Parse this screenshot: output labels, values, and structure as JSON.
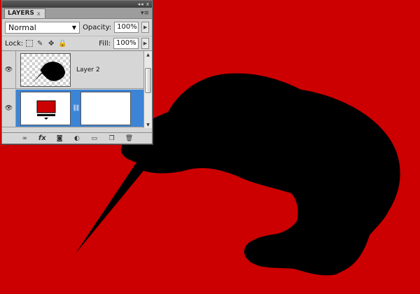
{
  "panel": {
    "tab_label": "LAYERS",
    "tab_close": "x",
    "menu_glyph": "▾≡",
    "titlebar_controls": "◂◂ x"
  },
  "blend": {
    "mode": "Normal",
    "opacity_label": "Opacity:",
    "opacity_value": "100%"
  },
  "lock": {
    "label": "Lock:",
    "fill_label": "Fill:",
    "fill_value": "100%"
  },
  "layers": [
    {
      "name": "Layer 2",
      "selected": false
    },
    {
      "name": "",
      "selected": true
    }
  ],
  "toolbar": {
    "link": "∞",
    "fx": "fx",
    "mask": "◙",
    "adjust": "◐",
    "group": "▭",
    "new": "❐",
    "trash": "🗑"
  },
  "colors": {
    "canvas_red": "#cc0000",
    "kiwi_black": "#000000",
    "selection_blue": "#3c84d6",
    "panel_gray": "#d6d6d6"
  },
  "icons": {
    "eye": "eye-icon",
    "chain": "chain-link-icon",
    "scroll_up": "scroll-up-arrow-icon",
    "scroll_down": "scroll-down-arrow-icon"
  }
}
